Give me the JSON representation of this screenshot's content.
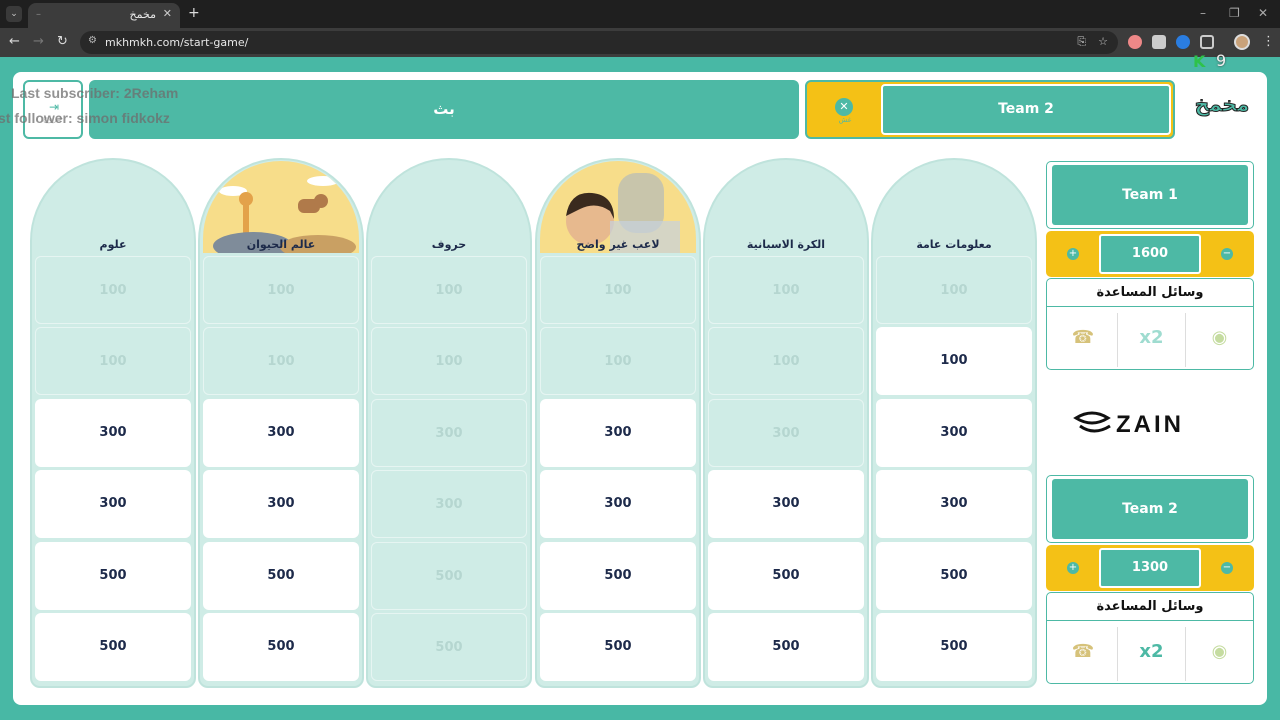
{
  "browser": {
    "tab_title": "مخمخ",
    "url": "mkhmkh.com/start-game/"
  },
  "overlay": {
    "subscriber_text": "Last subscriber: 2Reham",
    "follower_text": "st follower: simon fidkokz",
    "brand_letter": "K",
    "counter": "9"
  },
  "header": {
    "exit_label": "خروج",
    "turn_text": "بث",
    "current_team": "Team 2",
    "lock_label": "غش",
    "logo_text": "مخمخ"
  },
  "board": {
    "columns": [
      {
        "title": "علوم",
        "cells": [
          {
            "value": "100",
            "used": true
          },
          {
            "value": "100",
            "used": true
          },
          {
            "value": "300",
            "used": false
          },
          {
            "value": "300",
            "used": false
          },
          {
            "value": "500",
            "used": false
          },
          {
            "value": "500",
            "used": false
          }
        ]
      },
      {
        "title": "عالم الحيوان",
        "cells": [
          {
            "value": "100",
            "used": true
          },
          {
            "value": "100",
            "used": true
          },
          {
            "value": "300",
            "used": false
          },
          {
            "value": "300",
            "used": false
          },
          {
            "value": "500",
            "used": false
          },
          {
            "value": "500",
            "used": false
          }
        ]
      },
      {
        "title": "حروف",
        "cells": [
          {
            "value": "100",
            "used": true
          },
          {
            "value": "100",
            "used": true
          },
          {
            "value": "300",
            "used": true
          },
          {
            "value": "300",
            "used": true
          },
          {
            "value": "500",
            "used": true
          },
          {
            "value": "500",
            "used": true
          }
        ]
      },
      {
        "title": "لاعب غير واضح",
        "cells": [
          {
            "value": "100",
            "used": true
          },
          {
            "value": "100",
            "used": true
          },
          {
            "value": "300",
            "used": false
          },
          {
            "value": "300",
            "used": false
          },
          {
            "value": "500",
            "used": false
          },
          {
            "value": "500",
            "used": false
          }
        ]
      },
      {
        "title": "الكرة الاسبانية",
        "cells": [
          {
            "value": "100",
            "used": true
          },
          {
            "value": "100",
            "used": true
          },
          {
            "value": "300",
            "used": true
          },
          {
            "value": "300",
            "used": false
          },
          {
            "value": "500",
            "used": false
          },
          {
            "value": "500",
            "used": false
          }
        ]
      },
      {
        "title": "معلومات عامة",
        "cells": [
          {
            "value": "100",
            "used": true
          },
          {
            "value": "100",
            "used": false
          },
          {
            "value": "300",
            "used": false
          },
          {
            "value": "300",
            "used": false
          },
          {
            "value": "500",
            "used": false
          },
          {
            "value": "500",
            "used": false
          }
        ]
      }
    ]
  },
  "teams": [
    {
      "name": "Team 1",
      "score": "1600",
      "aids_title": "وسائل المساعدة"
    },
    {
      "name": "Team 2",
      "score": "1300",
      "aids_title": "وسائل المساعدة"
    }
  ],
  "aids_icons": [
    "call-friend-icon",
    "double-points-icon",
    "timer-icon"
  ],
  "sponsor": "ZAIN",
  "colors": {
    "teal": "#4db9a5",
    "yellow": "#f4c116",
    "light_teal": "#cfece6",
    "navy": "#1d2a4a"
  }
}
